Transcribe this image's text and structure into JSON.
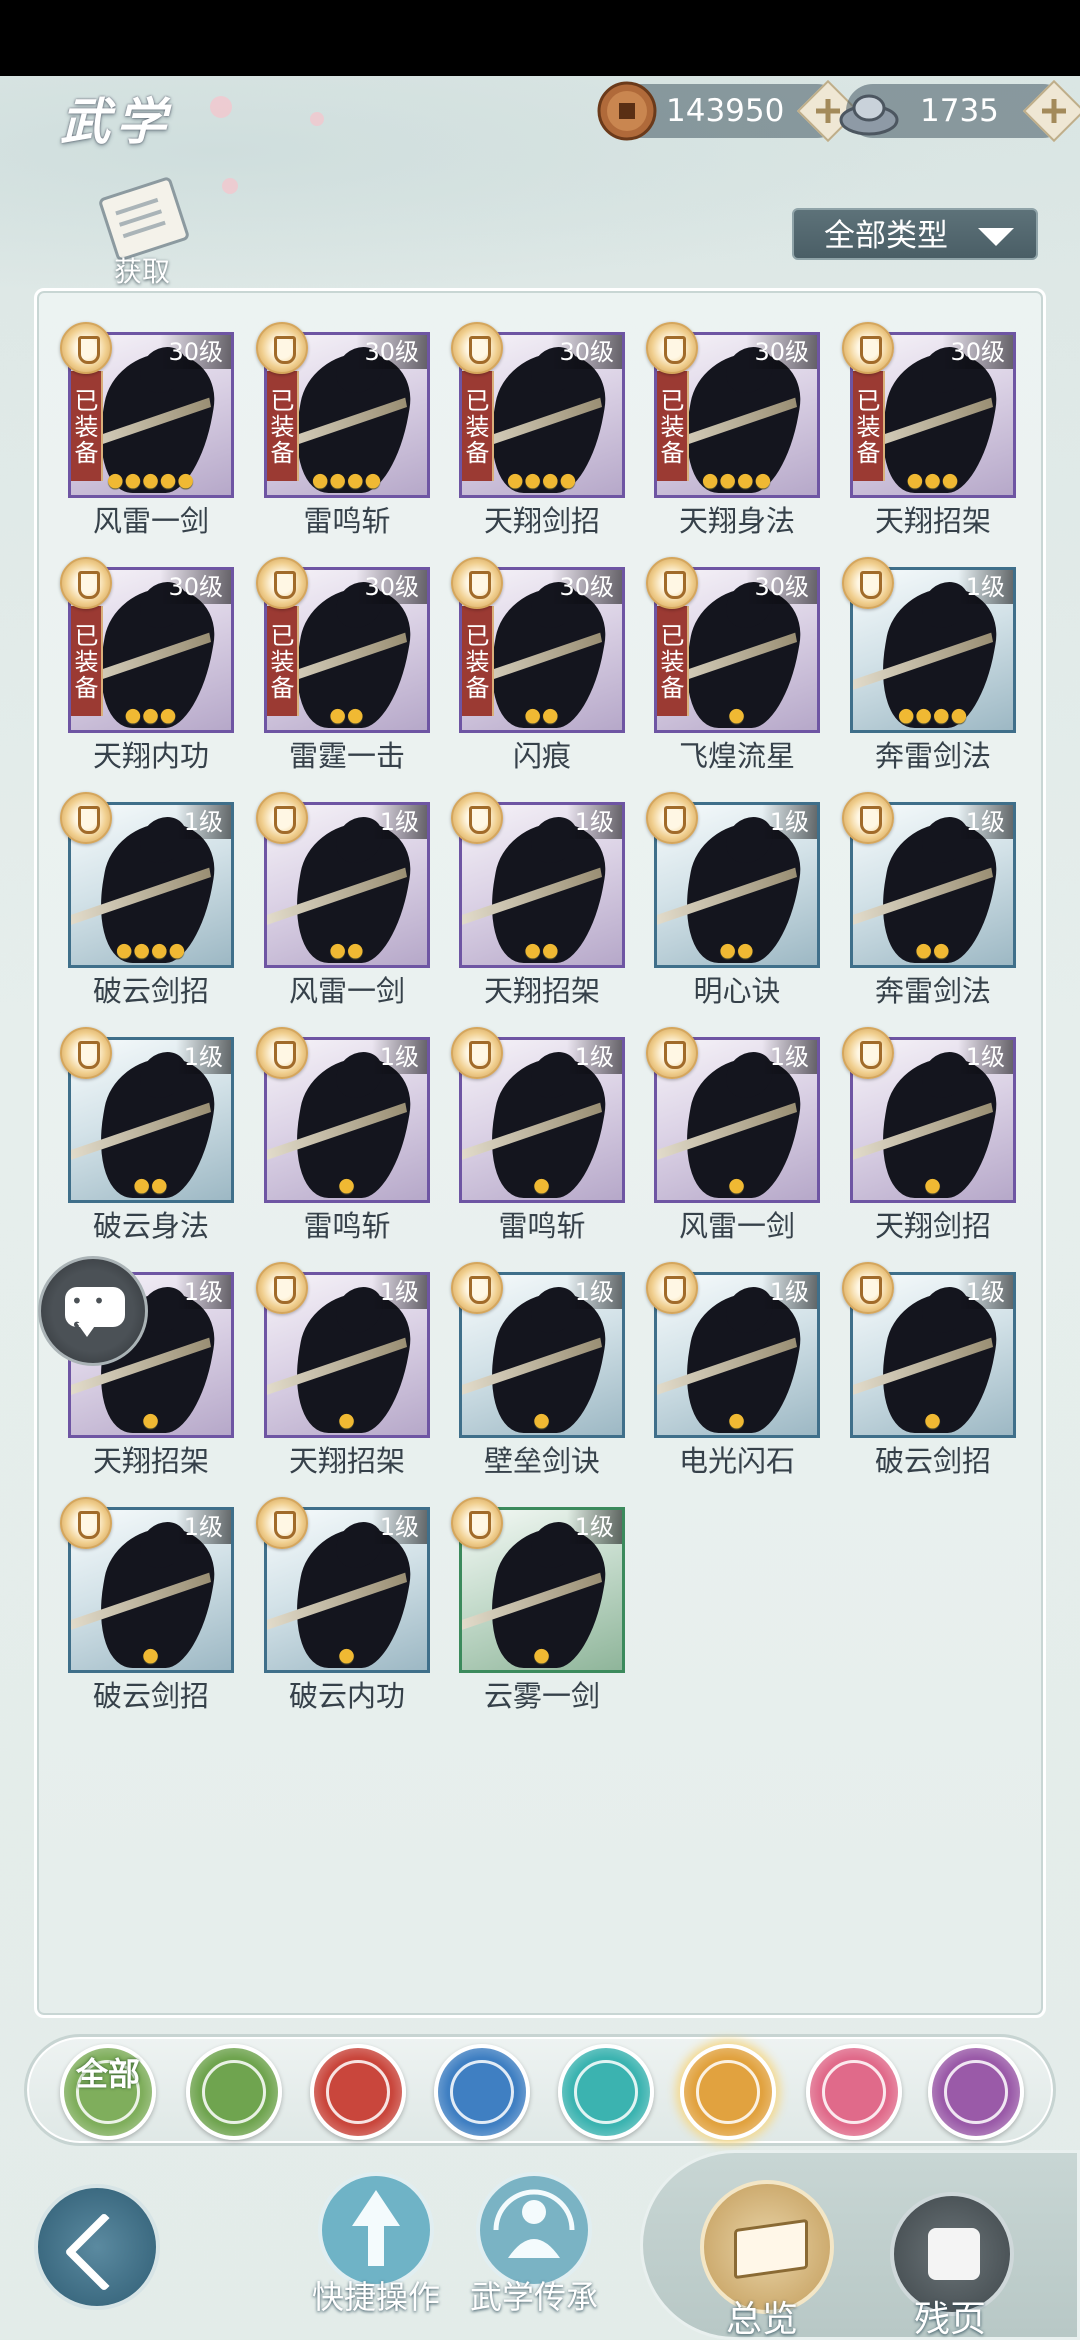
{
  "header": {
    "title": "武学",
    "acquire_label": "获取",
    "filter_label": "全部类型"
  },
  "currency": {
    "coins": "143950",
    "silver": "1735"
  },
  "grid": [
    {
      "name": "风雷一剑",
      "level": "30级",
      "equipped": "已装备",
      "stars": 5,
      "tier": "purple"
    },
    {
      "name": "雷鸣斩",
      "level": "30级",
      "equipped": "已装备",
      "stars": 4,
      "tier": "purple"
    },
    {
      "name": "天翔剑招",
      "level": "30级",
      "equipped": "已装备",
      "stars": 4,
      "tier": "purple"
    },
    {
      "name": "天翔身法",
      "level": "30级",
      "equipped": "已装备",
      "stars": 4,
      "tier": "purple"
    },
    {
      "name": "天翔招架",
      "level": "30级",
      "equipped": "已装备",
      "stars": 3,
      "tier": "purple"
    },
    {
      "name": "天翔内功",
      "level": "30级",
      "equipped": "已装备",
      "stars": 3,
      "tier": "purple"
    },
    {
      "name": "雷霆一击",
      "level": "30级",
      "equipped": "已装备",
      "stars": 2,
      "tier": "purple"
    },
    {
      "name": "闪痕",
      "level": "30级",
      "equipped": "已装备",
      "stars": 2,
      "tier": "purple"
    },
    {
      "name": "飞煌流星",
      "level": "30级",
      "equipped": "已装备",
      "stars": 1,
      "tier": "purple"
    },
    {
      "name": "奔雷剑法",
      "level": "1级",
      "equipped": "",
      "stars": 4,
      "tier": "blue"
    },
    {
      "name": "破云剑招",
      "level": "1级",
      "equipped": "",
      "stars": 4,
      "tier": "blue"
    },
    {
      "name": "风雷一剑",
      "level": "1级",
      "equipped": "",
      "stars": 2,
      "tier": "purple"
    },
    {
      "name": "天翔招架",
      "level": "1级",
      "equipped": "",
      "stars": 2,
      "tier": "purple"
    },
    {
      "name": "明心诀",
      "level": "1级",
      "equipped": "",
      "stars": 2,
      "tier": "blue"
    },
    {
      "name": "奔雷剑法",
      "level": "1级",
      "equipped": "",
      "stars": 2,
      "tier": "blue"
    },
    {
      "name": "破云身法",
      "level": "1级",
      "equipped": "",
      "stars": 2,
      "tier": "blue"
    },
    {
      "name": "雷鸣斩",
      "level": "1级",
      "equipped": "",
      "stars": 1,
      "tier": "purple"
    },
    {
      "name": "雷鸣斩",
      "level": "1级",
      "equipped": "",
      "stars": 1,
      "tier": "purple"
    },
    {
      "name": "风雷一剑",
      "level": "1级",
      "equipped": "",
      "stars": 1,
      "tier": "purple"
    },
    {
      "name": "天翔剑招",
      "level": "1级",
      "equipped": "",
      "stars": 1,
      "tier": "purple"
    },
    {
      "name": "天翔招架",
      "level": "1级",
      "equipped": "",
      "stars": 1,
      "tier": "purple"
    },
    {
      "name": "天翔招架",
      "level": "1级",
      "equipped": "",
      "stars": 1,
      "tier": "purple"
    },
    {
      "name": "壁垒剑诀",
      "level": "1级",
      "equipped": "",
      "stars": 1,
      "tier": "blue"
    },
    {
      "name": "电光闪石",
      "level": "1级",
      "equipped": "",
      "stars": 1,
      "tier": "blue"
    },
    {
      "name": "破云剑招",
      "level": "1级",
      "equipped": "",
      "stars": 1,
      "tier": "blue"
    },
    {
      "name": "破云剑招",
      "level": "1级",
      "equipped": "",
      "stars": 1,
      "tier": "blue"
    },
    {
      "name": "破云内功",
      "level": "1级",
      "equipped": "",
      "stars": 1,
      "tier": "blue"
    },
    {
      "name": "云雾一剑",
      "level": "1级",
      "equipped": "",
      "stars": 1,
      "tier": "green"
    }
  ],
  "type_filters": [
    {
      "label": "全部",
      "icon": "all-icon",
      "color": "#7fae5c"
    },
    {
      "label": "",
      "icon": "sword-icon",
      "color": "#6fa44f"
    },
    {
      "label": "",
      "icon": "flame-icon",
      "color": "#c9463c"
    },
    {
      "label": "",
      "icon": "wave-icon",
      "color": "#3f7fc2"
    },
    {
      "label": "",
      "icon": "butterfly-icon",
      "color": "#3bb3b0"
    },
    {
      "label": "",
      "icon": "shield-icon",
      "color": "#e1a23f"
    },
    {
      "label": "",
      "icon": "moon-icon",
      "color": "#e06a8a"
    },
    {
      "label": "",
      "icon": "rose-icon",
      "color": "#9a5aa8"
    }
  ],
  "bottom_nav": {
    "quick_ops": "快捷操作",
    "inheritance": "武学传承",
    "overview": "总览",
    "remnant": "残页"
  }
}
